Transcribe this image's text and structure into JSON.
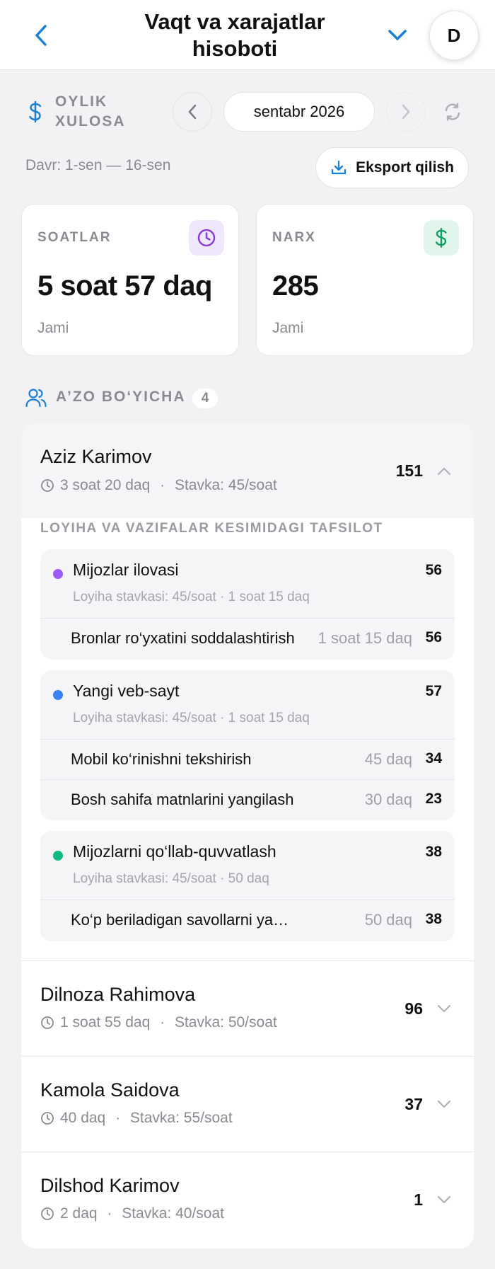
{
  "header": {
    "title": "Vaqt va xarajatlar hisoboti",
    "avatar_initial": "D"
  },
  "summary": {
    "label": "OYLIK XULOSA",
    "month": "sentabr 2026",
    "period": "Davr: 1-sen — 16-sen",
    "export_label": "Eksport qilish"
  },
  "stats": {
    "hours": {
      "label": "SOATLAR",
      "value": "5 soat 57 daq",
      "sub": "Jami"
    },
    "price": {
      "label": "NARX",
      "value": "285",
      "sub": "Jami"
    }
  },
  "members_section": {
    "title": "A’ZO BO‘YICHA",
    "count": "4",
    "detail_title": "LOYIHA VA VAZIFALAR KESIMIDAGI TAFSILOT"
  },
  "members": [
    {
      "name": "Aziz Karimov",
      "duration": "3 soat 20 daq",
      "rate": "Stavka: 45/soat",
      "total": "151",
      "expanded": true,
      "projects": [
        {
          "name": "Mijozlar ilovasi",
          "color": "#9b5cf6",
          "total": "56",
          "meta": "Loyiha stavkasi: 45/soat  ·  1 soat 15 daq",
          "tasks": [
            {
              "name": "Bronlar ro‘yxatini soddalashtirish",
              "duration": "1 soat 15 daq",
              "amount": "56"
            }
          ]
        },
        {
          "name": "Yangi veb-sayt",
          "color": "#3b82f6",
          "total": "57",
          "meta": "Loyiha stavkasi: 45/soat  ·  1 soat 15 daq",
          "tasks": [
            {
              "name": "Mobil ko‘rinishni tekshirish",
              "duration": "45 daq",
              "amount": "34"
            },
            {
              "name": "Bosh sahifa matnlarini yangilash",
              "duration": "30 daq",
              "amount": "23"
            }
          ]
        },
        {
          "name": "Mijozlarni qo‘llab-quvvatlash",
          "color": "#10b981",
          "total": "38",
          "meta": "Loyiha stavkasi: 45/soat  ·  50 daq",
          "tasks": [
            {
              "name": "Ko‘p beriladigan savollarni yangilash",
              "duration": "50 daq",
              "amount": "38"
            }
          ]
        }
      ]
    },
    {
      "name": "Dilnoza Rahimova",
      "duration": "1 soat 55 daq",
      "rate": "Stavka: 50/soat",
      "total": "96",
      "expanded": false
    },
    {
      "name": "Kamola Saidova",
      "duration": "40 daq",
      "rate": "Stavka: 55/soat",
      "total": "37",
      "expanded": false
    },
    {
      "name": "Dilshod Karimov",
      "duration": "2 daq",
      "rate": "Stavka: 40/soat",
      "total": "1",
      "expanded": false
    }
  ],
  "colors": {
    "accent_blue": "#1a7fd6",
    "muted_text": "#8a8a92",
    "purple_icon": "#8b3fd9",
    "green_icon": "#0f9d63"
  }
}
